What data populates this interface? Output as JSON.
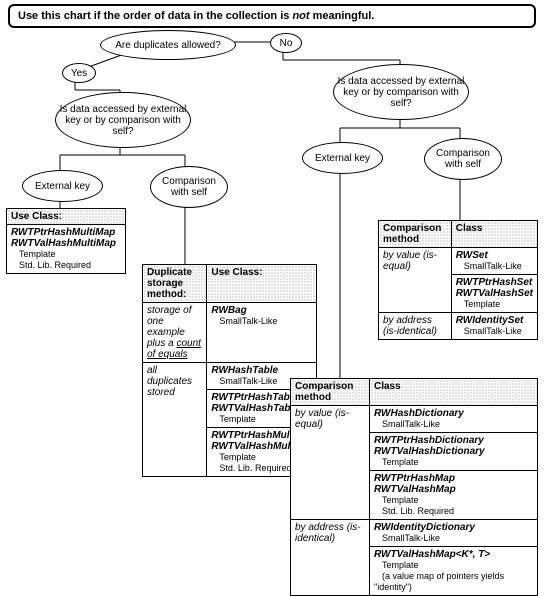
{
  "title_pre": "Use this chart if the order of data in the collection is ",
  "title_em": "not",
  "title_post": " meaningful.",
  "q_dup": "Are duplicates allowed?",
  "yes": "Yes",
  "no": "No",
  "q_access": "Is data accessed by external key or by comparison with self?",
  "ext_key": "External key",
  "comp_self": "Comparison with self",
  "tbl_left": {
    "hdr": "Use Class:",
    "c1": "RWTPtrHashMultiMap",
    "c2": "RWTValHashMultiMap",
    "n1": "Template",
    "n2": "Std. Lib. Required"
  },
  "tbl_dup": {
    "h1": "Duplicate storage method:",
    "h2": "Use Class:",
    "r1c1a": "storage of one example plus a",
    "r1c1b": "count of equals",
    "r1_a": "RWBag",
    "r1_b": "SmallTalk-Like",
    "r2c1": "all duplicates stored",
    "r2_a": "RWHashTable",
    "r2_b": "SmallTalk-Like",
    "r3_a": "RWTPtrHashTable",
    "r3_b": "RWTValHashTable",
    "r3_c": "Template",
    "r4_a": "RWTPtrHashMultiSet",
    "r4_b": "RWTValHashMultiSet",
    "r4_c": "Template",
    "r4_d": "Std. Lib. Required"
  },
  "tbl_comp": {
    "h1": "Comparison method",
    "h2": "Class",
    "r1c1": "by value (is-equal)",
    "r1_a": "RWSet",
    "r1_b": "SmallTalk-Like",
    "r2_a": "RWTPtrHashSet",
    "r2_b": "RWTValHashSet",
    "r2_c": "Template",
    "r3c1": "by address (is-identical)",
    "r3_a": "RWIdentitySet",
    "r3_b": "SmallTalk-Like"
  },
  "tbl_ext": {
    "h1": "Comparison method",
    "h2": "Class",
    "r1c1": "by value (is-equal)",
    "r1_a": "RWHashDictionary",
    "r1_b": "SmallTalk-Like",
    "r2_a": "RWTPtrHashDictionary",
    "r2_b": "RWTValHashDictionary",
    "r2_c": "Template",
    "r3_a": "RWTPtrHashMap",
    "r3_b": "RWTValHashMap",
    "r3_c": "Template",
    "r3_d": "Std. Lib. Required",
    "r4c1": "by address (is-identical)",
    "r4_a": "RWIdentityDictionary",
    "r4_b": "SmallTalk-Like",
    "r5_a": "RWTValHashMap<K*, T>",
    "r5_b": "Template",
    "r5_c": "(a value map of pointers yields \"identity\")"
  }
}
